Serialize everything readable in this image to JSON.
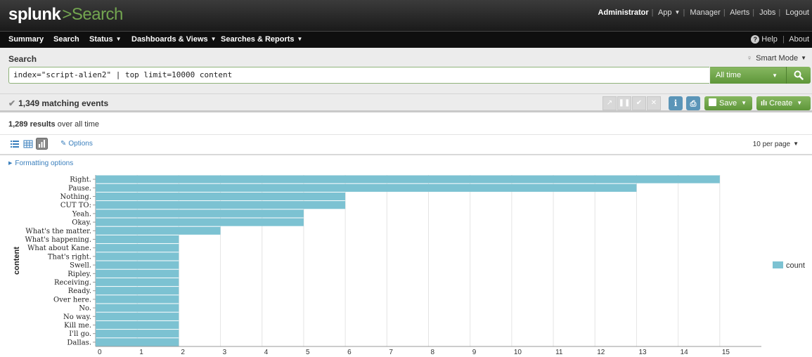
{
  "app": {
    "brand": "splunk",
    "separator": ">",
    "name": "Search",
    "top_links": [
      "Administrator",
      "App",
      "Manager",
      "Alerts",
      "Jobs",
      "Logout"
    ]
  },
  "nav": {
    "items": [
      "Summary",
      "Search",
      "Status",
      "Dashboards & Views",
      "Searches & Reports"
    ],
    "help": "Help",
    "about": "About"
  },
  "search": {
    "title": "Search",
    "mode": "Smart Mode",
    "query": "index=\"script-alien2\" | top limit=10000 content",
    "time_range": "All time"
  },
  "job": {
    "matching_events": "1,349 matching events",
    "save_label": "Save",
    "create_label": "Create",
    "info_label": "i"
  },
  "results": {
    "count": "1,289 results",
    "suffix": " over all time",
    "options_label": "Options",
    "per_page": "10 per page",
    "formatting_label": "Formatting options"
  },
  "colors": {
    "bar": "#7cc2d2",
    "accent_green": "#5e9639",
    "link_blue": "#3a7fbd"
  },
  "chart_data": {
    "type": "bar",
    "orientation": "horizontal",
    "ylabel": "content",
    "xlabel": "",
    "xlim": [
      0,
      16
    ],
    "x_ticks": [
      0,
      1,
      2,
      3,
      4,
      5,
      6,
      7,
      8,
      9,
      10,
      11,
      12,
      13,
      14,
      15
    ],
    "grid": true,
    "legend_position": "right",
    "categories": [
      "Right.",
      "Pause.",
      "Nothing.",
      "CUT TO:",
      "Yeah.",
      "Okay.",
      "What's the matter.",
      "What's happening.",
      "What about Kane.",
      "That's right.",
      "Swell.",
      "Ripley.",
      "Receiving.",
      "Ready.",
      "Over here.",
      "No.",
      "No way.",
      "Kill me.",
      "I'll go.",
      "Dallas."
    ],
    "series": [
      {
        "name": "count",
        "values": [
          15,
          13,
          6,
          6,
          5,
          5,
          3,
          2,
          2,
          2,
          2,
          2,
          2,
          2,
          2,
          2,
          2,
          2,
          2,
          2
        ]
      }
    ]
  }
}
